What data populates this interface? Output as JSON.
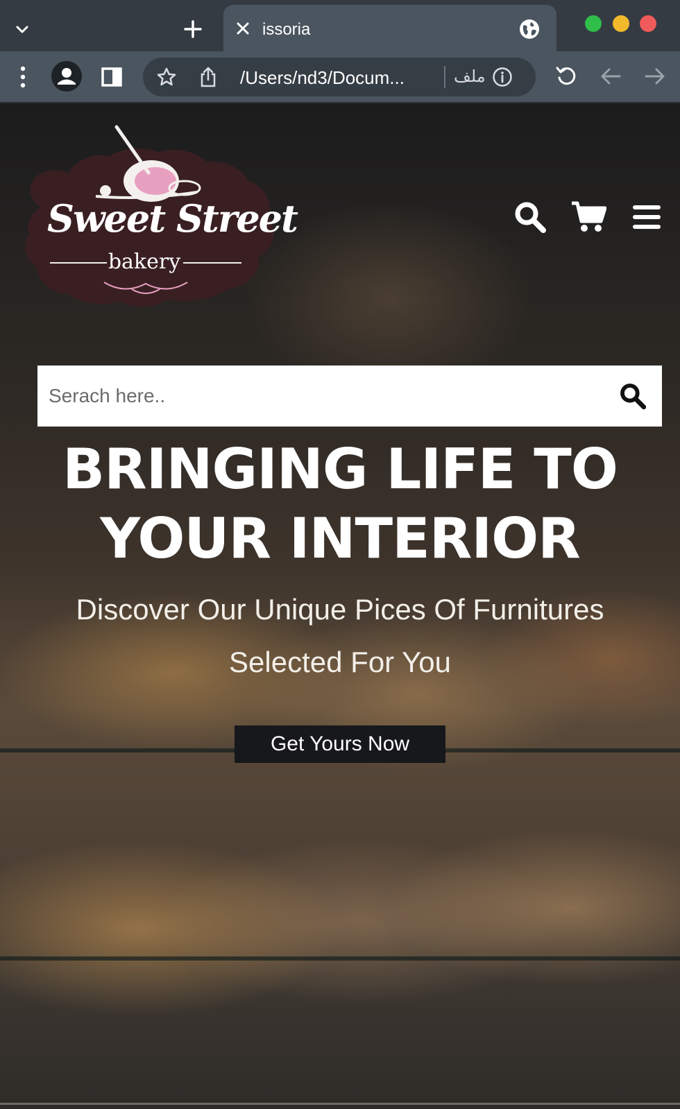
{
  "browser": {
    "tab_title": "issoria",
    "url": "/Users/nd3/Docum...",
    "file_label": "ملف"
  },
  "header": {
    "brand_script": "Sweet Street",
    "brand_sub": "bakery"
  },
  "search": {
    "placeholder": "Serach here.."
  },
  "hero": {
    "title": "BRINGING LIFE TO YOUR INTERIOR",
    "subtitle": "Discover Our Unique Pices Of Furnitures Selected For You",
    "cta_label": "Get Yours Now"
  },
  "colors": {
    "logo_bg": "#3a1f22",
    "logo_accent": "#e8a0c0",
    "cta_bg": "#17181c",
    "chrome_dark": "#343b42",
    "chrome_toolbar": "#4a555f"
  },
  "icons": [
    "chevron-down-icon",
    "plus-icon",
    "close-icon",
    "globe-icon",
    "menu-dots-icon",
    "profile-icon",
    "sidebar-icon",
    "star-icon",
    "share-icon",
    "info-icon",
    "reload-icon",
    "back-arrow-icon",
    "forward-arrow-icon",
    "search-icon",
    "cart-icon",
    "hamburger-icon"
  ]
}
